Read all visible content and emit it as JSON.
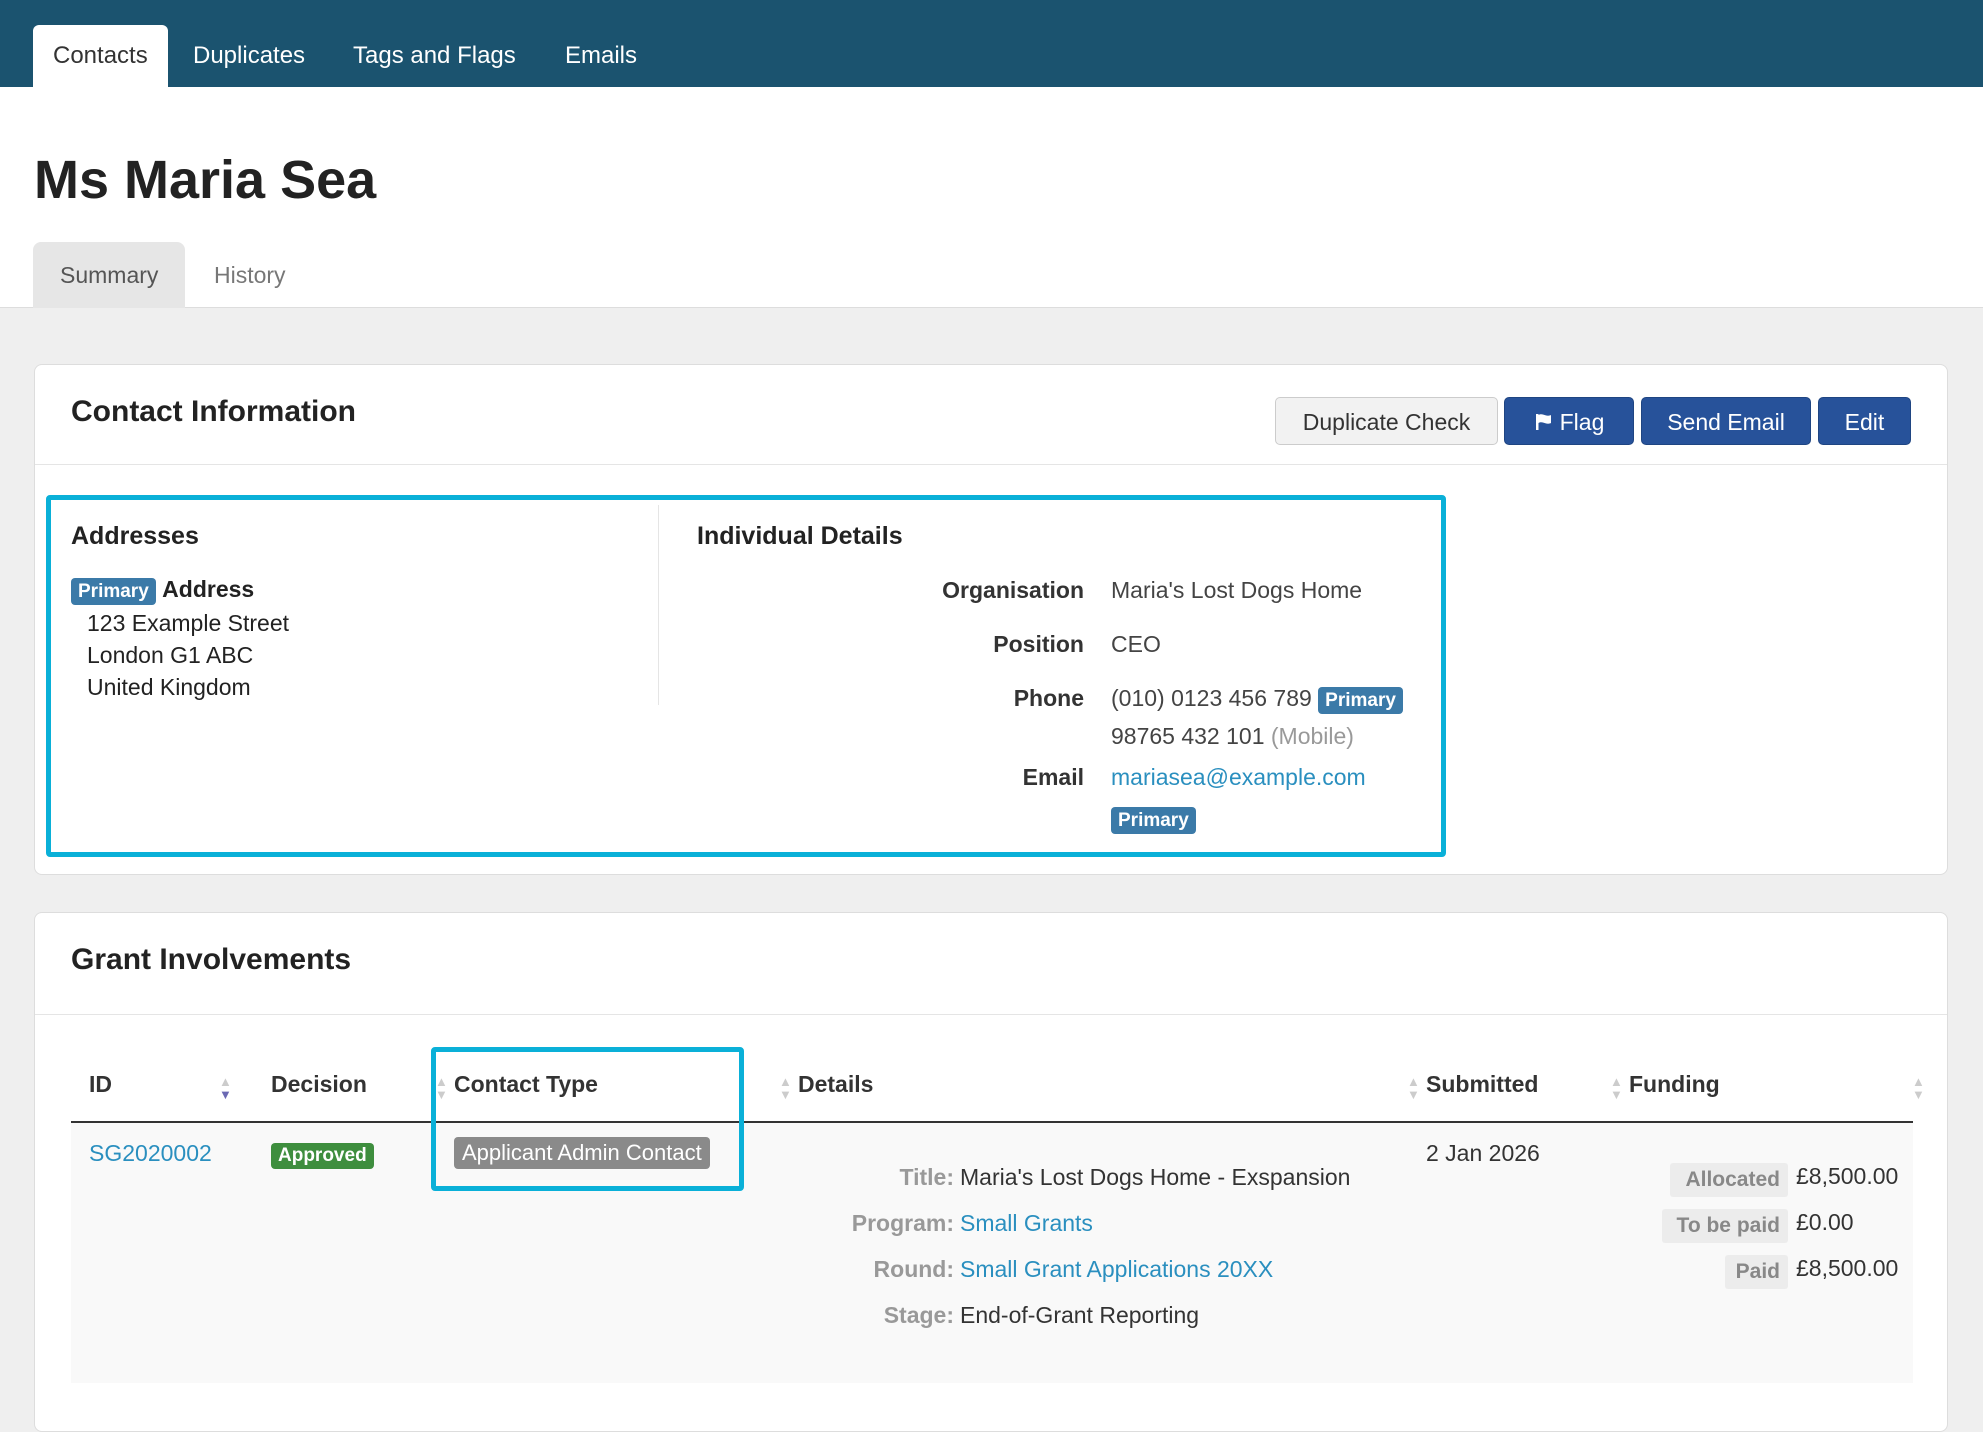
{
  "nav": {
    "tabs": [
      "Contacts",
      "Duplicates",
      "Tags and Flags",
      "Emails"
    ]
  },
  "page": {
    "title": "Ms Maria Sea",
    "subtabs": [
      "Summary",
      "History"
    ]
  },
  "contact_info": {
    "title": "Contact Information",
    "buttons": {
      "duplicate_check": "Duplicate Check",
      "flag": "Flag",
      "send_email": "Send Email",
      "edit": "Edit"
    },
    "addresses": {
      "heading": "Addresses",
      "badge": "Primary",
      "label": "Address",
      "lines": [
        "123 Example Street",
        "London G1 ABC",
        "United Kingdom"
      ]
    },
    "individual": {
      "heading": "Individual Details",
      "organisation_label": "Organisation",
      "organisation": "Maria's Lost Dogs Home",
      "position_label": "Position",
      "position": "CEO",
      "phone_label": "Phone",
      "phone1": "(010) 0123 456 789",
      "phone1_badge": "Primary",
      "phone2": "98765 432 101",
      "phone2_note": "(Mobile)",
      "email_label": "Email",
      "email": "mariasea@example.com",
      "email_badge": "Primary"
    }
  },
  "grants": {
    "title": "Grant Involvements",
    "columns": [
      "ID",
      "Decision",
      "Contact Type",
      "Details",
      "Submitted",
      "Funding"
    ],
    "row": {
      "id": "SG2020002",
      "decision": "Approved",
      "contact_type": "Applicant Admin Contact",
      "details": {
        "title_label": "Title:",
        "title": "Maria's Lost Dogs Home - Exspansion",
        "program_label": "Program:",
        "program": "Small Grants",
        "round_label": "Round:",
        "round": "Small Grant Applications 20XX",
        "stage_label": "Stage:",
        "stage": "End-of-Grant Reporting"
      },
      "submitted": "2 Jan 2026",
      "funding": {
        "allocated_label": "Allocated",
        "allocated": "£8,500.00",
        "to_be_paid_label": "To be paid",
        "to_be_paid": "£0.00",
        "paid_label": "Paid",
        "paid": "£8,500.00"
      }
    }
  },
  "colors": {
    "nav": "#1b536f",
    "primary_button": "#27529a",
    "highlight": "#0ab0d8",
    "badge": "#3b7aa8",
    "approved": "#3e8e3e",
    "link": "#2a8fbf"
  }
}
